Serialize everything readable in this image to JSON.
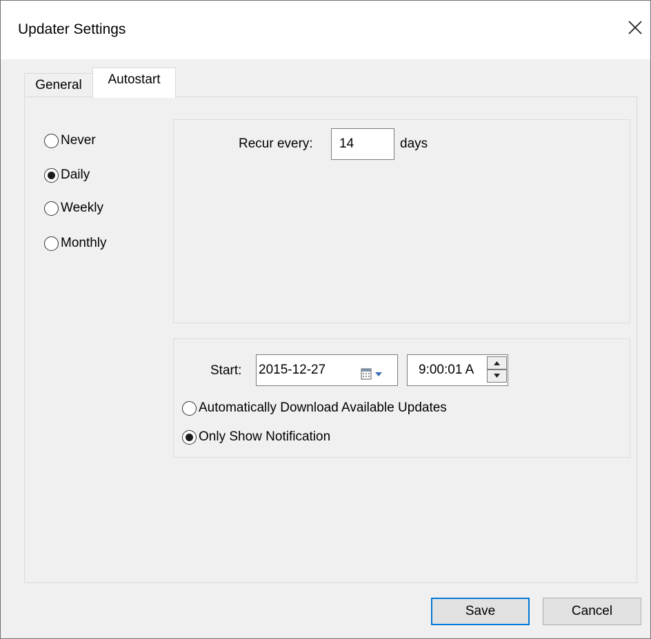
{
  "window": {
    "title": "Updater Settings"
  },
  "tabs": [
    {
      "label": "General",
      "active": false
    },
    {
      "label": "Autostart",
      "active": true
    }
  ],
  "schedule": {
    "options": [
      {
        "label": "Never",
        "checked": false
      },
      {
        "label": "Daily",
        "checked": true
      },
      {
        "label": "Weekly",
        "checked": false
      },
      {
        "label": "Monthly",
        "checked": false
      }
    ]
  },
  "recurrence": {
    "label": "Recur every:",
    "value": "14",
    "unit": "days"
  },
  "start": {
    "label": "Start:",
    "date": "2015-12-27",
    "time": "9:00:01 A"
  },
  "update_mode": {
    "options": [
      {
        "label": "Automatically Download Available Updates",
        "checked": false
      },
      {
        "label": "Only Show Notification",
        "checked": true
      }
    ]
  },
  "buttons": {
    "save": "Save",
    "cancel": "Cancel"
  },
  "colors": {
    "accent": "#0078d7",
    "window_bg": "#f0f0f0"
  }
}
